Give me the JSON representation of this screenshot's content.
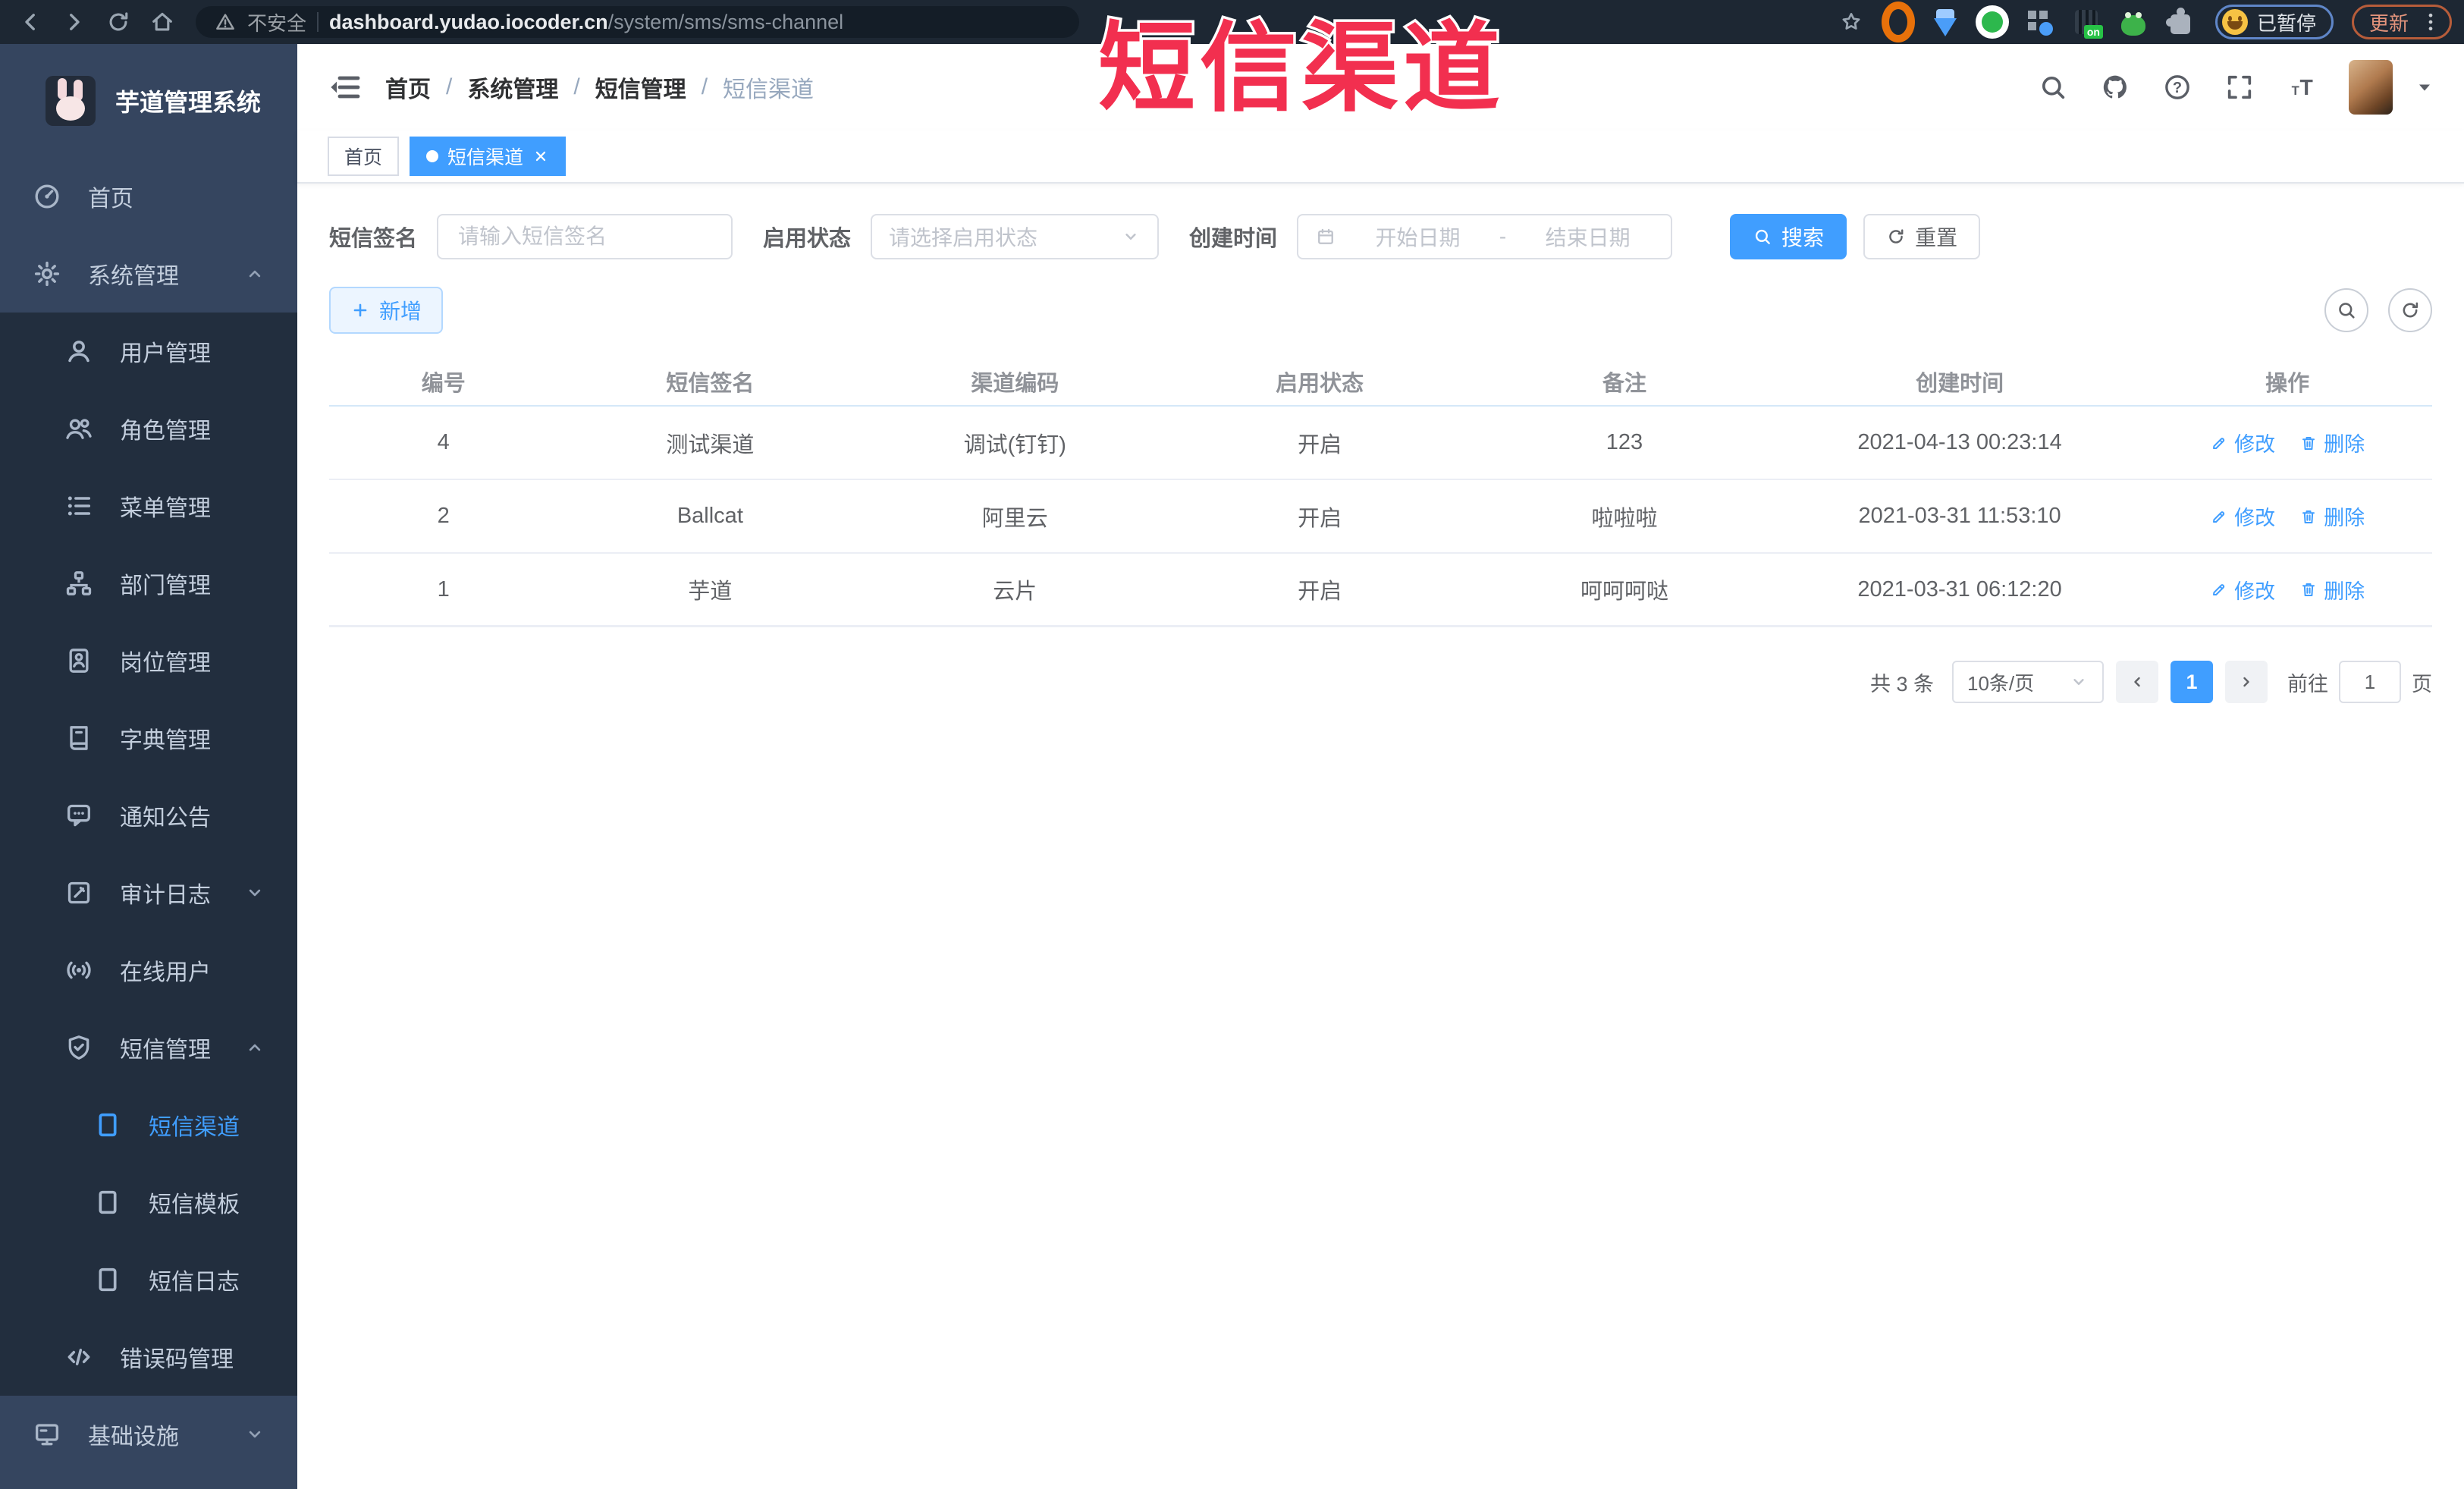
{
  "theme": {
    "accent": "#409eff",
    "annotation_color": "#f22f4f",
    "sidebar_bg": "#35455f",
    "submenu_bg": "#222e3e",
    "browser_bar_bg": "#1d2733"
  },
  "browser": {
    "nav_icons": [
      "back-icon",
      "forward-icon",
      "reload-icon",
      "home-icon"
    ],
    "security_label": "不安全",
    "url_domain": "dashboard.yudao.iocoder.cn",
    "url_path": "/system/sms/sms-channel",
    "bookmark_icon": "star-icon",
    "extensions": [
      "orange-extension-icon",
      "gem-extension-icon",
      "green-extension-icon",
      "grid-extension-icon",
      "onoff-extension-icon",
      "frog-extension-icon",
      "puzzle-extension-icon"
    ],
    "profile_label": "已暂停",
    "update_label": "更新"
  },
  "overlay": {
    "annotation": "短信渠道"
  },
  "sidebar": {
    "logo_title": "芋道管理系统",
    "items": [
      {
        "key": "home",
        "label": "首页",
        "level": 1,
        "icon": "dashboard-icon",
        "section": "base"
      },
      {
        "key": "system",
        "label": "系统管理",
        "level": 1,
        "icon": "gear-icon",
        "section": "base",
        "chevron": "up"
      },
      {
        "key": "user",
        "label": "用户管理",
        "level": 2,
        "icon": "user-icon",
        "section": "sub"
      },
      {
        "key": "role",
        "label": "角色管理",
        "level": 2,
        "icon": "role-icon",
        "section": "sub"
      },
      {
        "key": "menu",
        "label": "菜单管理",
        "level": 2,
        "icon": "menu-list-icon",
        "section": "sub"
      },
      {
        "key": "dept",
        "label": "部门管理",
        "level": 2,
        "icon": "org-tree-icon",
        "section": "sub"
      },
      {
        "key": "post",
        "label": "岗位管理",
        "level": 2,
        "icon": "post-icon",
        "section": "sub"
      },
      {
        "key": "dict",
        "label": "字典管理",
        "level": 2,
        "icon": "dict-icon",
        "section": "sub"
      },
      {
        "key": "notice",
        "label": "通知公告",
        "level": 2,
        "icon": "notice-icon",
        "section": "sub"
      },
      {
        "key": "audit-log",
        "label": "审计日志",
        "level": 2,
        "icon": "log-icon",
        "section": "sub",
        "chevron": "down"
      },
      {
        "key": "online-user",
        "label": "在线用户",
        "level": 2,
        "icon": "online-icon",
        "section": "sub"
      },
      {
        "key": "sms",
        "label": "短信管理",
        "level": 2,
        "icon": "sms-icon",
        "section": "sub",
        "chevron": "up"
      },
      {
        "key": "sms-channel",
        "label": "短信渠道",
        "level": 3,
        "icon": "doc-icon",
        "section": "sub",
        "active": true
      },
      {
        "key": "sms-template",
        "label": "短信模板",
        "level": 3,
        "icon": "doc-icon",
        "section": "sub"
      },
      {
        "key": "sms-log",
        "label": "短信日志",
        "level": 3,
        "icon": "doc-icon",
        "section": "sub"
      },
      {
        "key": "error-code",
        "label": "错误码管理",
        "level": 2,
        "icon": "code-icon",
        "section": "sub"
      },
      {
        "key": "infra",
        "label": "基础设施",
        "level": 1,
        "icon": "monitor-icon",
        "section": "base",
        "chevron": "down"
      }
    ]
  },
  "header": {
    "breadcrumb": [
      "首页",
      "系统管理",
      "短信管理",
      "短信渠道"
    ],
    "action_icons": [
      "search-icon",
      "github-icon",
      "help-icon",
      "fullscreen-icon",
      "font-size-icon"
    ]
  },
  "tabs": [
    {
      "label": "首页",
      "active": false,
      "closable": false
    },
    {
      "label": "短信渠道",
      "active": true,
      "closable": true
    }
  ],
  "filters": {
    "sign_label": "短信签名",
    "sign_placeholder": "请输入短信签名",
    "status_label": "启用状态",
    "status_placeholder": "请选择启用状态",
    "time_label": "创建时间",
    "start_placeholder": "开始日期",
    "range_separator": "-",
    "end_placeholder": "结束日期",
    "search_label": "搜索",
    "reset_label": "重置"
  },
  "toolbar": {
    "add_label": "新增"
  },
  "table": {
    "headers": [
      "编号",
      "短信签名",
      "渠道编码",
      "启用状态",
      "备注",
      "创建时间",
      "操作"
    ],
    "edit_label": "修改",
    "delete_label": "删除",
    "rows": [
      {
        "id": "4",
        "sign": "测试渠道",
        "code": "调试(钉钉)",
        "status": "开启",
        "remark": "123",
        "created": "2021-04-13 00:23:14"
      },
      {
        "id": "2",
        "sign": "Ballcat",
        "code": "阿里云",
        "status": "开启",
        "remark": "啦啦啦",
        "created": "2021-03-31 11:53:10"
      },
      {
        "id": "1",
        "sign": "芋道",
        "code": "云片",
        "status": "开启",
        "remark": "呵呵呵哒",
        "created": "2021-03-31 06:12:20"
      }
    ]
  },
  "pagination": {
    "total": "共 3 条",
    "page_size": "10条/页",
    "current": "1",
    "goto_label": "前往",
    "goto_value": "1",
    "page_unit": "页"
  }
}
